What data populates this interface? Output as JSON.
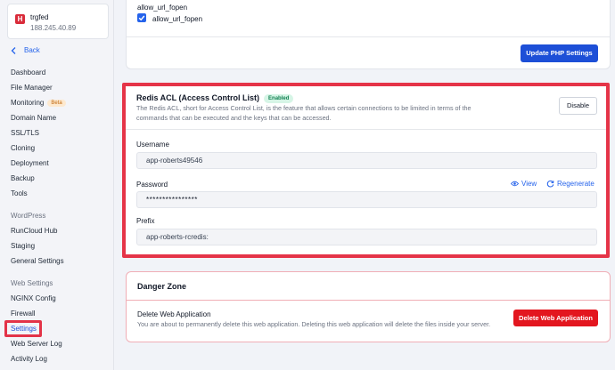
{
  "server": {
    "logo": "H",
    "name": "trgfed",
    "ip": "188.245.40.89"
  },
  "nav": {
    "back_label": "Back",
    "items_main": [
      "Dashboard",
      "File Manager",
      "Monitoring",
      "Domain Name",
      "SSL/TLS",
      "Cloning",
      "Deployment",
      "Backup",
      "Tools"
    ],
    "beta_label": "Beta",
    "section_wordpress": "WordPress",
    "items_wordpress": [
      "RunCloud Hub",
      "Staging",
      "General Settings"
    ],
    "section_web": "Web Settings",
    "items_web": [
      "NGINX Config",
      "Firewall",
      "Settings",
      "Web Server Log",
      "Activity Log"
    ]
  },
  "php": {
    "label": "allow_url_fopen",
    "checkbox_label": "allow_url_fopen",
    "update_button": "Update PHP Settings"
  },
  "redis": {
    "title": "Redis ACL (Access Control List)",
    "status_badge": "Enabled",
    "description": "The Redis ACL, short for Access Control List, is the feature that allows certain connections to be limited in terms of the commands that can be executed and the keys that can be accessed.",
    "disable_button": "Disable",
    "username_label": "Username",
    "username_value": "app-roberts49546",
    "password_label": "Password",
    "password_value": "****************",
    "view_label": "View",
    "regenerate_label": "Regenerate",
    "prefix_label": "Prefix",
    "prefix_value": "app-roberts-rcredis:"
  },
  "danger": {
    "title": "Danger Zone",
    "subtitle": "Delete Web Application",
    "description": "You are about to permanently delete this web application. Deleting this web application will delete the files inside your server.",
    "delete_button": "Delete Web Application"
  },
  "colors": {
    "accent": "#1d4fd7",
    "highlight": "#e53448",
    "danger": "#e3161f",
    "logo": "#d92b3a"
  }
}
